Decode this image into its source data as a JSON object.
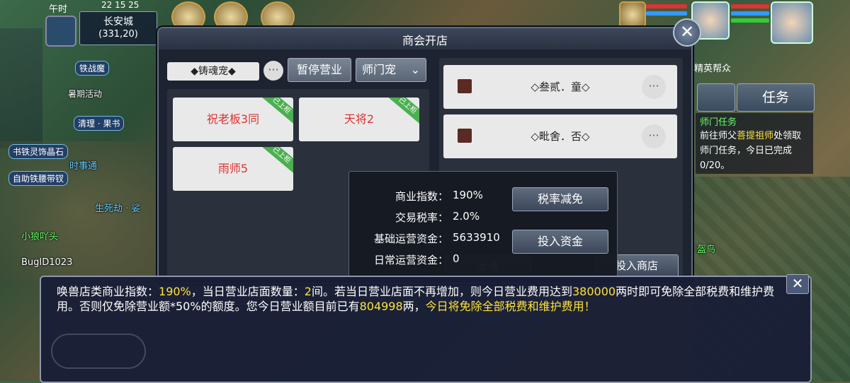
{
  "status": {
    "time_period": "午时",
    "clock": "22 15 25",
    "city": "长安城",
    "coords": "(331,20)"
  },
  "left_hud": {
    "tags": [
      "铁战魔",
      "暑期活动",
      "清理 · 果书",
      "书铁灵饰晶石",
      "自助铁腰带钗"
    ],
    "npc_names": [
      "时事通",
      "生死劫 · 娑",
      "小狼吖头",
      "BugID1023"
    ]
  },
  "right_hud": {
    "gang_label": "精英帮众",
    "task_button": "任务",
    "quest_title": "师门任务",
    "quest_desc_prefix": "前往师父",
    "quest_master": "菩提祖师",
    "quest_desc_suffix": "处领取师门任务，今日已完成0/20。",
    "npc_right": "盔鸟"
  },
  "dialog": {
    "title": "商会开店",
    "close_icon": "close-icon",
    "shop_name": "◆铸魂宠◆",
    "more_label": "···",
    "pause_button": "暂停营业",
    "category_select": "师门宠",
    "goods": [
      {
        "name": "祝老板3同",
        "tag": "已上柜"
      },
      {
        "name": "天将2",
        "tag": "已上柜"
      },
      {
        "name": "雨师5",
        "tag": "已上柜"
      }
    ],
    "pets": [
      {
        "name": "◇叁贰．童◇"
      },
      {
        "name": "◇毗舍．否◇"
      }
    ],
    "behind_left": "全选",
    "behind_right": "投入商店"
  },
  "info": {
    "rows": [
      {
        "key": "商业指数：",
        "value": "190%"
      },
      {
        "key": "交易税率：",
        "value": "2.0%"
      },
      {
        "key": "基础运营资金：",
        "value": "5633910"
      },
      {
        "key": "日常运营资金：",
        "value": "0"
      }
    ],
    "tax_button": "税率减免",
    "invest_button": "投入资金"
  },
  "tooltip": {
    "p1": "唤兽店类商业指数：",
    "v1": "190%",
    "p2": "，当日营业店面数量：",
    "v2": "2",
    "p3": "间。若当日营业店面不再增加，则今日营业费用达到",
    "v3": "380000",
    "p4": "两时即可免除全部税费和维护费用。否则仅免除营业额*50%的额度。您今日营业额目前已有",
    "v4": "804998",
    "p5": "两，",
    "v5": "今日将免除全部税费和维护费用！",
    "close_label": "✕"
  },
  "colors": {
    "highlight": "#ffe23c",
    "goods_text": "#d33333"
  }
}
